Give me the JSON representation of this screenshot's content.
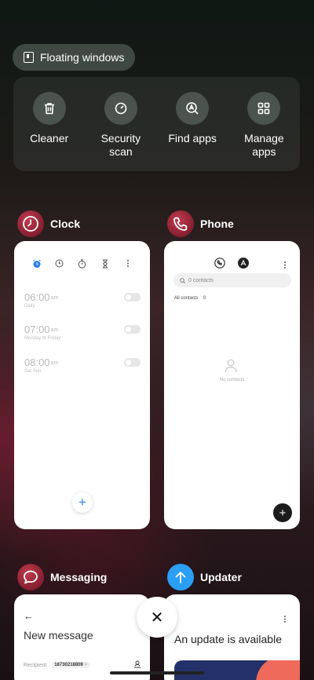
{
  "floating_windows": {
    "label": "Floating windows"
  },
  "quick_actions": [
    {
      "label": "Cleaner",
      "icon": "trash-icon"
    },
    {
      "label": "Security\nscan",
      "icon": "shield-scan-icon"
    },
    {
      "label": "Find apps",
      "icon": "find-apps-icon"
    },
    {
      "label": "Manage\napps",
      "icon": "grid-icon"
    }
  ],
  "apps": {
    "clock": {
      "name": "Clock",
      "alarms": [
        {
          "time": "06:00",
          "ampm": "am",
          "repeat": "Daily"
        },
        {
          "time": "07:00",
          "ampm": "am",
          "repeat": "Monday to Friday"
        },
        {
          "time": "08:00",
          "ampm": "am",
          "repeat": "Sat Sun"
        }
      ],
      "fab": "+"
    },
    "phone": {
      "name": "Phone",
      "search_placeholder": "0 contacts",
      "all_contacts_label": "All contacts",
      "all_contacts_count": "0",
      "no_contacts": "No contacts",
      "fab": "+"
    },
    "messaging": {
      "name": "Messaging",
      "title": "New message",
      "back": "←",
      "recipient_label": "Recipient",
      "recipient_value": "18730218809",
      "chip_close": "×"
    },
    "updater": {
      "name": "Updater",
      "title": "An update is available"
    }
  },
  "close_button": "✕",
  "colors": {
    "accent_blue": "#2b7de9",
    "updater_blue": "#2b9ef5",
    "promo_orange": "#ef6a5a",
    "promo_navy": "#23306a"
  }
}
